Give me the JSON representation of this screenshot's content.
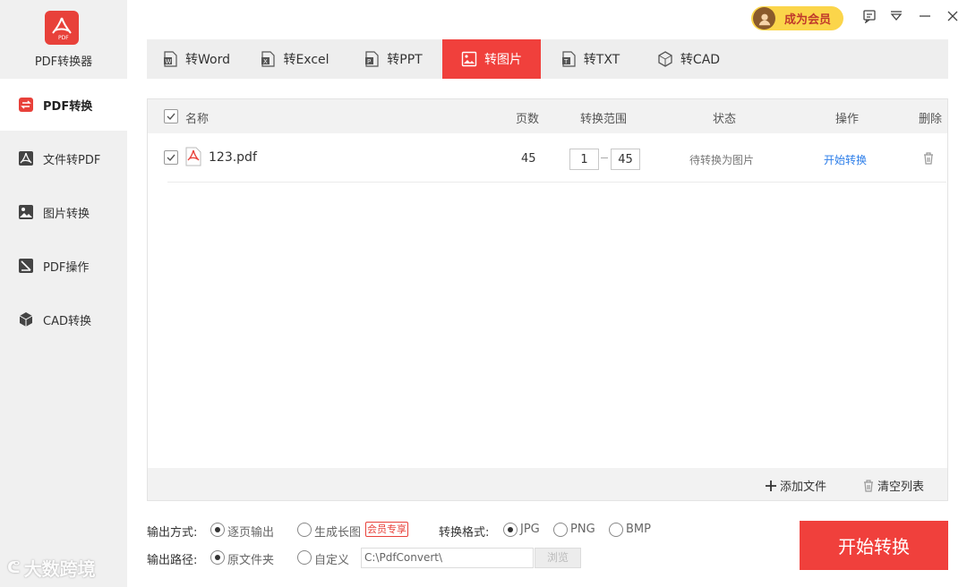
{
  "app": {
    "name": "PDF转换器"
  },
  "sidebar": {
    "items": [
      {
        "label": "PDF转换",
        "icon": "convert-icon"
      },
      {
        "label": "文件转PDF",
        "icon": "pdf-icon"
      },
      {
        "label": "图片转换",
        "icon": "image-icon"
      },
      {
        "label": "PDF操作",
        "icon": "edit-icon"
      },
      {
        "label": "CAD转换",
        "icon": "cube-icon"
      }
    ]
  },
  "watermark": "大数跨境",
  "topbar": {
    "vip_label": "成为会员"
  },
  "tabs": [
    {
      "label": "转Word",
      "icon": "word-icon"
    },
    {
      "label": "转Excel",
      "icon": "excel-icon"
    },
    {
      "label": "转PPT",
      "icon": "ppt-icon"
    },
    {
      "label": "转图片",
      "icon": "image-icon"
    },
    {
      "label": "转TXT",
      "icon": "txt-icon"
    },
    {
      "label": "转CAD",
      "icon": "cad-icon"
    }
  ],
  "table": {
    "headers": {
      "name": "名称",
      "pages": "页数",
      "range": "转换范围",
      "status": "状态",
      "action": "操作",
      "delete": "删除"
    },
    "rows": [
      {
        "name": "123.pdf",
        "pages": "45",
        "range_from": "1",
        "range_to": "45",
        "status": "待转换为图片",
        "action": "开始转换"
      }
    ],
    "footer": {
      "add_file": "添加文件",
      "clear_list": "清空列表"
    }
  },
  "options": {
    "output_mode_label": "输出方式:",
    "output_mode_options": [
      "逐页输出",
      "生成长图"
    ],
    "vip_tag": "会员专享",
    "format_label": "转换格式:",
    "format_options": [
      "JPG",
      "PNG",
      "BMP"
    ],
    "path_label": "输出路径:",
    "path_options": [
      "原文件夹",
      "自定义"
    ],
    "path_value": "C:\\PdfConvert\\",
    "browse_label": "浏览"
  },
  "start_button": "开始转换",
  "colors": {
    "accent": "#f0403c",
    "link": "#2b7de9",
    "vip": "#fbd54a"
  }
}
